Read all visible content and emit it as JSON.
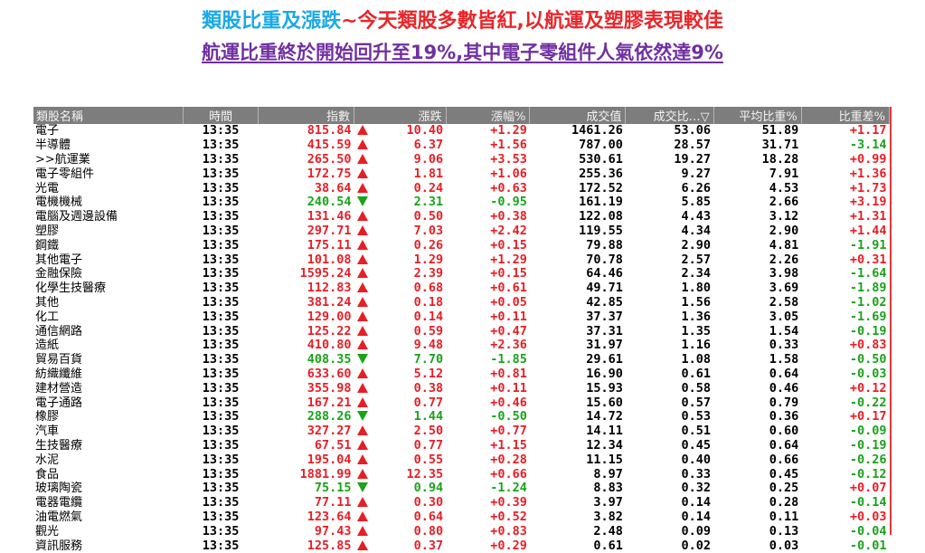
{
  "headline": {
    "part1": "類股比重及漲跌",
    "part2": "~今天類股多數皆紅,以航運及塑膠表現較佳",
    "line2": "航運比重終於開始回升至19%,其中電子零組件人氣依然達9%"
  },
  "colors": {
    "up": "#e81e25",
    "down": "#19a319",
    "header_bg": "#7d7d7d",
    "title_blue": "#1ca9e6",
    "subtitle_purple": "#7030a0"
  },
  "table": {
    "headers": [
      "類股名稱",
      "時間",
      "指數",
      "漲跌",
      "漲幅%",
      "成交值",
      "成交比…▽",
      "平均比重%",
      "比重差%"
    ],
    "rows": [
      {
        "name": "電子",
        "time": "13:35",
        "index": "815.84",
        "dir": "up",
        "chg": "10.40",
        "pct": "+1.29",
        "val": "1461.26",
        "ratio": "53.06",
        "avg": "51.89",
        "diff": "+1.17"
      },
      {
        "name": "半導體",
        "time": "13:35",
        "index": "415.59",
        "dir": "up",
        "chg": "6.37",
        "pct": "+1.56",
        "val": "787.00",
        "ratio": "28.57",
        "avg": "31.71",
        "diff": "-3.14"
      },
      {
        "name": ">>航運業",
        "time": "13:35",
        "index": "265.50",
        "dir": "up",
        "chg": "9.06",
        "pct": "+3.53",
        "val": "530.61",
        "ratio": "19.27",
        "avg": "18.28",
        "diff": "+0.99"
      },
      {
        "name": "電子零組件",
        "time": "13:35",
        "index": "172.75",
        "dir": "up",
        "chg": "1.81",
        "pct": "+1.06",
        "val": "255.36",
        "ratio": "9.27",
        "avg": "7.91",
        "diff": "+1.36"
      },
      {
        "name": "光電",
        "time": "13:35",
        "index": "38.64",
        "dir": "up",
        "chg": "0.24",
        "pct": "+0.63",
        "val": "172.52",
        "ratio": "6.26",
        "avg": "4.53",
        "diff": "+1.73"
      },
      {
        "name": "電機機械",
        "time": "13:35",
        "index": "240.54",
        "dir": "down",
        "chg": "2.31",
        "pct": "-0.95",
        "val": "161.19",
        "ratio": "5.85",
        "avg": "2.66",
        "diff": "+3.19"
      },
      {
        "name": "電腦及週邊設備",
        "time": "13:35",
        "index": "131.46",
        "dir": "up",
        "chg": "0.50",
        "pct": "+0.38",
        "val": "122.08",
        "ratio": "4.43",
        "avg": "3.12",
        "diff": "+1.31"
      },
      {
        "name": "塑膠",
        "time": "13:35",
        "index": "297.71",
        "dir": "up",
        "chg": "7.03",
        "pct": "+2.42",
        "val": "119.55",
        "ratio": "4.34",
        "avg": "2.90",
        "diff": "+1.44"
      },
      {
        "name": "鋼鐵",
        "time": "13:35",
        "index": "175.11",
        "dir": "up",
        "chg": "0.26",
        "pct": "+0.15",
        "val": "79.88",
        "ratio": "2.90",
        "avg": "4.81",
        "diff": "-1.91"
      },
      {
        "name": "其他電子",
        "time": "13:35",
        "index": "101.08",
        "dir": "up",
        "chg": "1.29",
        "pct": "+1.29",
        "val": "70.78",
        "ratio": "2.57",
        "avg": "2.26",
        "diff": "+0.31"
      },
      {
        "name": "金融保險",
        "time": "13:35",
        "index": "1595.24",
        "dir": "up",
        "chg": "2.39",
        "pct": "+0.15",
        "val": "64.46",
        "ratio": "2.34",
        "avg": "3.98",
        "diff": "-1.64"
      },
      {
        "name": "化學生技醫療",
        "time": "13:35",
        "index": "112.83",
        "dir": "up",
        "chg": "0.68",
        "pct": "+0.61",
        "val": "49.71",
        "ratio": "1.80",
        "avg": "3.69",
        "diff": "-1.89"
      },
      {
        "name": "其他",
        "time": "13:35",
        "index": "381.24",
        "dir": "up",
        "chg": "0.18",
        "pct": "+0.05",
        "val": "42.85",
        "ratio": "1.56",
        "avg": "2.58",
        "diff": "-1.02"
      },
      {
        "name": "化工",
        "time": "13:35",
        "index": "129.00",
        "dir": "up",
        "chg": "0.14",
        "pct": "+0.11",
        "val": "37.37",
        "ratio": "1.36",
        "avg": "3.05",
        "diff": "-1.69"
      },
      {
        "name": "通信網路",
        "time": "13:35",
        "index": "125.22",
        "dir": "up",
        "chg": "0.59",
        "pct": "+0.47",
        "val": "37.31",
        "ratio": "1.35",
        "avg": "1.54",
        "diff": "-0.19"
      },
      {
        "name": "造紙",
        "time": "13:35",
        "index": "410.80",
        "dir": "up",
        "chg": "9.48",
        "pct": "+2.36",
        "val": "31.97",
        "ratio": "1.16",
        "avg": "0.33",
        "diff": "+0.83"
      },
      {
        "name": "貿易百貨",
        "time": "13:35",
        "index": "408.35",
        "dir": "down",
        "chg": "7.70",
        "pct": "-1.85",
        "val": "29.61",
        "ratio": "1.08",
        "avg": "1.58",
        "diff": "-0.50"
      },
      {
        "name": "紡織纖維",
        "time": "13:35",
        "index": "633.60",
        "dir": "up",
        "chg": "5.12",
        "pct": "+0.81",
        "val": "16.90",
        "ratio": "0.61",
        "avg": "0.64",
        "diff": "-0.03"
      },
      {
        "name": "建材營造",
        "time": "13:35",
        "index": "355.98",
        "dir": "up",
        "chg": "0.38",
        "pct": "+0.11",
        "val": "15.93",
        "ratio": "0.58",
        "avg": "0.46",
        "diff": "+0.12"
      },
      {
        "name": "電子通路",
        "time": "13:35",
        "index": "167.21",
        "dir": "up",
        "chg": "0.77",
        "pct": "+0.46",
        "val": "15.60",
        "ratio": "0.57",
        "avg": "0.79",
        "diff": "-0.22"
      },
      {
        "name": "橡膠",
        "time": "13:35",
        "index": "288.26",
        "dir": "down",
        "chg": "1.44",
        "pct": "-0.50",
        "val": "14.72",
        "ratio": "0.53",
        "avg": "0.36",
        "diff": "+0.17"
      },
      {
        "name": "汽車",
        "time": "13:35",
        "index": "327.27",
        "dir": "up",
        "chg": "2.50",
        "pct": "+0.77",
        "val": "14.11",
        "ratio": "0.51",
        "avg": "0.60",
        "diff": "-0.09"
      },
      {
        "name": "生技醫療",
        "time": "13:35",
        "index": "67.51",
        "dir": "up",
        "chg": "0.77",
        "pct": "+1.15",
        "val": "12.34",
        "ratio": "0.45",
        "avg": "0.64",
        "diff": "-0.19"
      },
      {
        "name": "水泥",
        "time": "13:35",
        "index": "195.04",
        "dir": "up",
        "chg": "0.55",
        "pct": "+0.28",
        "val": "11.15",
        "ratio": "0.40",
        "avg": "0.66",
        "diff": "-0.26"
      },
      {
        "name": "食品",
        "time": "13:35",
        "index": "1881.99",
        "dir": "up",
        "chg": "12.35",
        "pct": "+0.66",
        "val": "8.97",
        "ratio": "0.33",
        "avg": "0.45",
        "diff": "-0.12"
      },
      {
        "name": "玻璃陶瓷",
        "time": "13:35",
        "index": "75.15",
        "dir": "down",
        "chg": "0.94",
        "pct": "-1.24",
        "val": "8.83",
        "ratio": "0.32",
        "avg": "0.25",
        "diff": "+0.07"
      },
      {
        "name": "電器電纜",
        "time": "13:35",
        "index": "77.11",
        "dir": "up",
        "chg": "0.30",
        "pct": "+0.39",
        "val": "3.97",
        "ratio": "0.14",
        "avg": "0.28",
        "diff": "-0.14"
      },
      {
        "name": "油電燃氣",
        "time": "13:35",
        "index": "123.64",
        "dir": "up",
        "chg": "0.64",
        "pct": "+0.52",
        "val": "3.82",
        "ratio": "0.14",
        "avg": "0.11",
        "diff": "+0.03"
      },
      {
        "name": "觀光",
        "time": "13:35",
        "index": "97.43",
        "dir": "up",
        "chg": "0.80",
        "pct": "+0.83",
        "val": "2.48",
        "ratio": "0.09",
        "avg": "0.13",
        "diff": "-0.04"
      },
      {
        "name": "資訊服務",
        "time": "13:35",
        "index": "125.85",
        "dir": "up",
        "chg": "0.37",
        "pct": "+0.29",
        "val": "0.61",
        "ratio": "0.02",
        "avg": "0.03",
        "diff": "-0.01"
      }
    ]
  }
}
